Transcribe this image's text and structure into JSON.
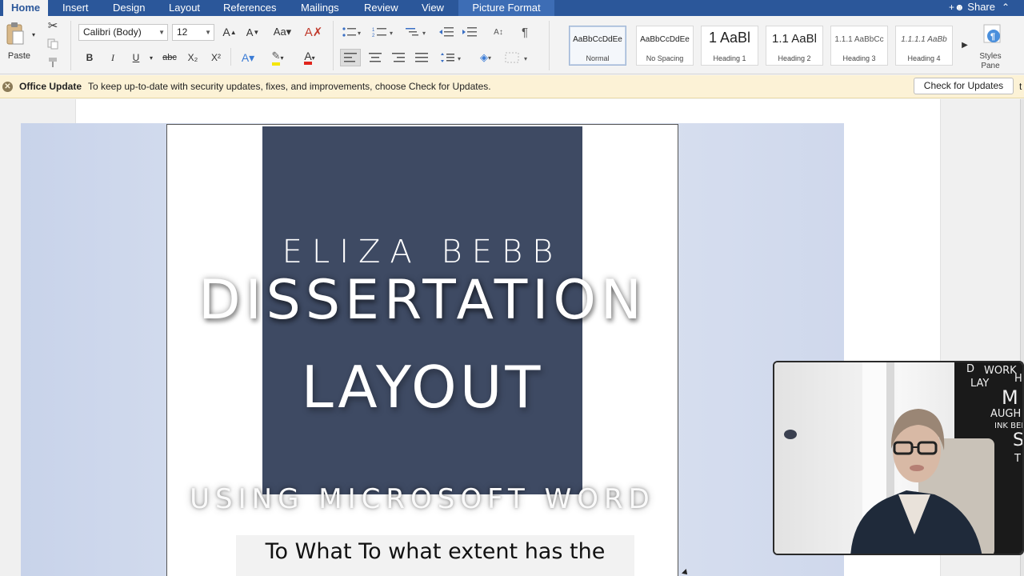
{
  "ribbon_tabs": [
    {
      "label": "Home",
      "active": true
    },
    {
      "label": "Insert"
    },
    {
      "label": "Design"
    },
    {
      "label": "Layout"
    },
    {
      "label": "References"
    },
    {
      "label": "Mailings"
    },
    {
      "label": "Review"
    },
    {
      "label": "View"
    },
    {
      "label": "Picture Format",
      "contextual": true
    }
  ],
  "share": {
    "icon": "add-person-icon",
    "label": "Share"
  },
  "clipboard": {
    "paste_label": "Paste"
  },
  "font": {
    "family": "Calibri (Body)",
    "size": "12"
  },
  "format_buttons": {
    "bold": "B",
    "italic": "I",
    "underline": "U",
    "strike": "abc",
    "subscript": "X₂",
    "superscript": "X²"
  },
  "styles": [
    {
      "preview": "AaBbCcDdEe",
      "name": "Normal",
      "selected": true
    },
    {
      "preview": "AaBbCcDdEe",
      "name": "No Spacing"
    },
    {
      "preview": "1  AaBl",
      "name": "Heading 1"
    },
    {
      "preview": "1.1  AaBl",
      "name": "Heading 2"
    },
    {
      "preview": "1.1.1  AaBbCc",
      "name": "Heading 3"
    },
    {
      "preview": "1.1.1.1  AaBb",
      "name": "Heading 4"
    }
  ],
  "styles_pane": {
    "line1": "Styles",
    "line2": "Pane"
  },
  "update_bar": {
    "title": "Office Update",
    "message": "To keep up-to-date with security updates, fixes, and improvements, choose Check for Updates.",
    "button": "Check for Updates",
    "overflow": "t"
  },
  "document": {
    "author": "ELIZA BEBB",
    "title_line1": "DISSERTATION",
    "title_line2": "LAYOUT",
    "subtitle": "USING MICROSOFT WORD",
    "question": "To What To what extent has the"
  },
  "colors": {
    "ribbon_blue": "#2b579a",
    "navy_block": "#3e4a63",
    "update_bar": "#fcf2d6"
  }
}
